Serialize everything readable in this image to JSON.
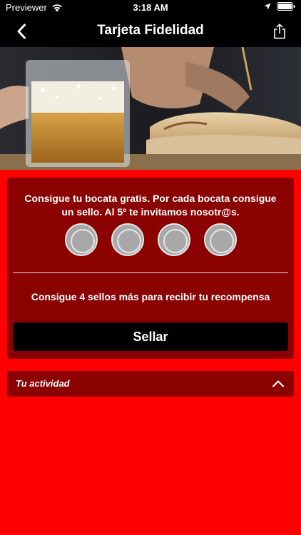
{
  "status_bar": {
    "carrier": "Previewer",
    "time": "3:18 AM",
    "icons": [
      "wifi-icon",
      "location-arrow-icon",
      "battery-icon"
    ]
  },
  "nav": {
    "title": "Tarjeta Fidelidad",
    "left_icon": "chevron-left-icon",
    "right_icon": "share-icon"
  },
  "hero": {
    "icon": "hero-photo-beer-and-sandwich"
  },
  "card": {
    "description": "Consigue tu bocata gratis. Por cada bocata consigue un sello. Al 5º te invitamos nosotr@s.",
    "stamps_collected": 0,
    "stamps_shown": 4,
    "remaining_text": "Consigue 4 sellos más para recibir tu recompensa",
    "button_label": "Sellar"
  },
  "activity": {
    "label": "Tu actividad",
    "icon": "chevron-up-icon"
  },
  "colors": {
    "background": "#ff0000",
    "card": "#8b0000",
    "bars": "#000000",
    "text": "#ffffff"
  }
}
